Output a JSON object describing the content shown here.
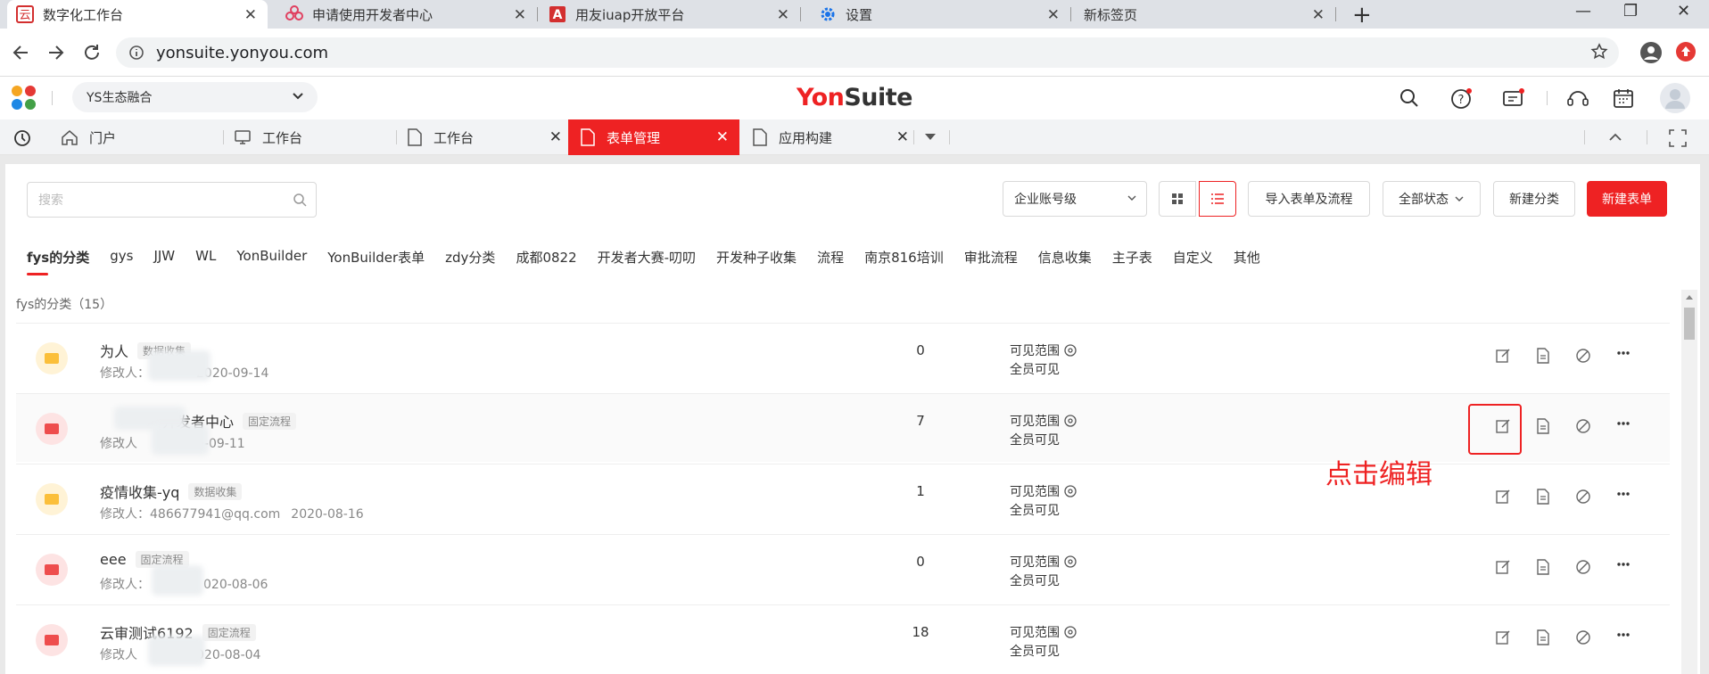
{
  "browser": {
    "tabs": [
      {
        "title": "数字化工作台",
        "icon": "yun-logo-icon",
        "active": true
      },
      {
        "title": "申请使用开发者中心",
        "icon": "flower-logo-icon"
      },
      {
        "title": "用友iuap开放平台",
        "icon": "letter-a-logo-icon"
      },
      {
        "title": "设置",
        "icon": "gear-icon"
      },
      {
        "title": "新标签页",
        "icon": ""
      }
    ],
    "new_tab": "+",
    "url": "yonsuite.yonyou.com"
  },
  "app": {
    "ecosystem_select": "YS生态融合",
    "logo_left": "Yon",
    "logo_right": "Suite",
    "brand_color": "#ee2223",
    "work_tabs": [
      {
        "label": "门户",
        "icon": "home-icon"
      },
      {
        "label": "工作台",
        "icon": "monitor-icon"
      },
      {
        "label": "工作台",
        "icon": "document-icon",
        "closable": true
      },
      {
        "label": "表单管理",
        "icon": "document-icon",
        "closable": true,
        "active": true
      },
      {
        "label": "应用构建",
        "icon": "document-icon",
        "closable": true
      }
    ]
  },
  "toolbar": {
    "search_placeholder": "搜索",
    "account_select": "企业账号级",
    "import_label": "导入表单及流程",
    "status_select": "全部状态",
    "new_category": "新建分类",
    "new_form": "新建表单"
  },
  "categories": [
    "fys的分类",
    "gys",
    "JJW",
    "WL",
    "YonBuilder",
    "YonBuilder表单",
    "zdy分类",
    "成都0822",
    "开发者大赛-叨叨",
    "开发种子收集",
    "流程",
    "南京816培训",
    "审批流程",
    "信息收集",
    "主子表",
    "自定义",
    "其他"
  ],
  "list": {
    "count_label": "fys的分类（15）",
    "rows": [
      {
        "name": "为人",
        "tag": "数据收集",
        "modifier_label": "修改人：",
        "date": "2020-09-14",
        "num": "0",
        "vis_label": "可见范围",
        "vis_value": "全员可见",
        "color": "#fbbf3a"
      },
      {
        "name": "开发者中心",
        "tag": "固定流程",
        "modifier_label": "修改人",
        "date": "0-09-11",
        "num": "7",
        "vis_label": "可见范围",
        "vis_value": "全员可见",
        "color": "#ee4d4d"
      },
      {
        "name": "疫情收集-yq",
        "tag": "数据收集",
        "modifier_label": "修改人：486677941@qq.com",
        "date": "2020-08-16",
        "num": "1",
        "vis_label": "可见范围",
        "vis_value": "全员可见",
        "color": "#fbbf3a"
      },
      {
        "name": "eee",
        "tag": "固定流程",
        "modifier_label": "修改人：",
        "date": "020-08-06",
        "num": "0",
        "vis_label": "可见范围",
        "vis_value": "全员可见",
        "color": "#ee4d4d"
      },
      {
        "name": "云审测试6192",
        "tag": "固定流程",
        "modifier_label": "修改人",
        "date": "020-08-04",
        "num": "18",
        "vis_label": "可见范围",
        "vis_value": "全员可见",
        "color": "#ee4d4d"
      }
    ]
  },
  "annotation": "点击编辑"
}
